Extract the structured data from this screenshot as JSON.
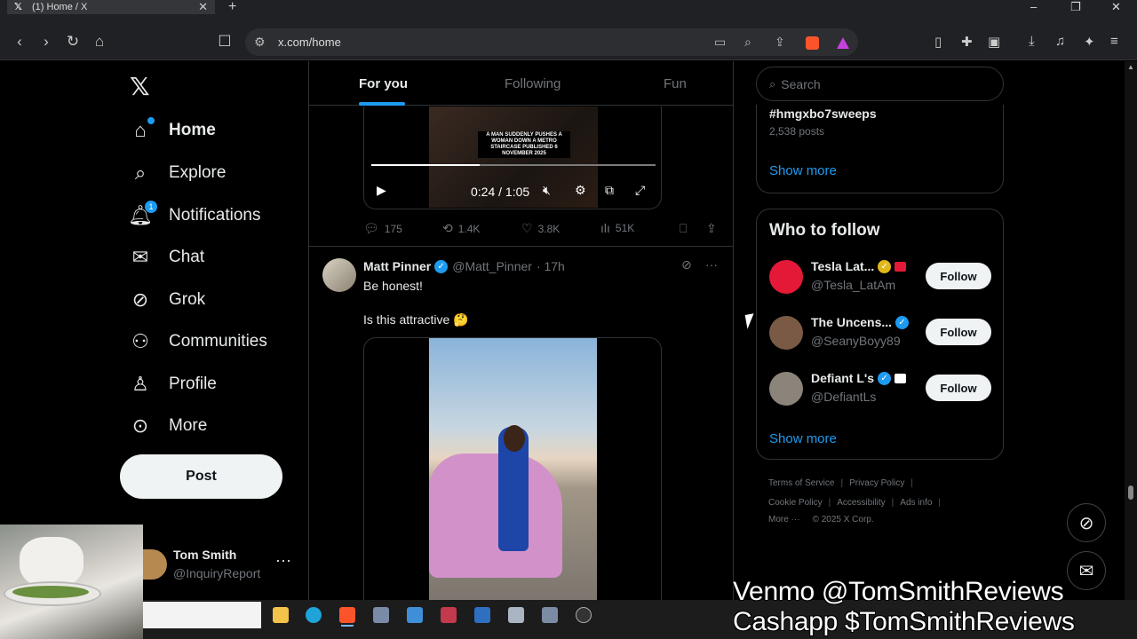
{
  "browser": {
    "tab_title": "(1) Home / X",
    "tab_icon": "x-logo-icon",
    "new_tab": "+",
    "url": "x.com/home",
    "window_controls": [
      "–",
      "❐",
      "✕"
    ]
  },
  "left_nav": {
    "logo": "𝕏",
    "items": [
      {
        "label": "Home",
        "icon": "home-icon",
        "active": true
      },
      {
        "label": "Explore",
        "icon": "search-icon"
      },
      {
        "label": "Notifications",
        "icon": "bell-icon",
        "badge": "1"
      },
      {
        "label": "Chat",
        "icon": "mail-icon"
      },
      {
        "label": "Grok",
        "icon": "grok-icon"
      },
      {
        "label": "Communities",
        "icon": "people-icon"
      },
      {
        "label": "Profile",
        "icon": "person-icon"
      },
      {
        "label": "More",
        "icon": "more-circle-icon"
      }
    ],
    "post_button": "Post",
    "account": {
      "name": "Tom Smith",
      "handle": "@InquiryReport",
      "more": "···"
    }
  },
  "feed": {
    "tabs": [
      {
        "label": "For you",
        "selected": true
      },
      {
        "label": "Following",
        "selected": false
      },
      {
        "label": "Fun",
        "selected": false
      }
    ],
    "video1": {
      "caption": "A MAN SUDDENLY PUSHES A WOMAN DOWN A METRO STAIRCASE PUBLISHED 6 NOVEMBER 2025",
      "time": "0:24 / 1:05",
      "progress": 0.38
    },
    "tweet1_actions": {
      "replies": "175",
      "reposts": "1.4K",
      "likes": "3.8K",
      "views": "51K"
    },
    "tweet2": {
      "name": "Matt Pinner",
      "handle": "@Matt_Pinner",
      "time": "· 17h",
      "line1": "Be honest!",
      "line2": "Is this attractive 🤔"
    }
  },
  "right": {
    "search_placeholder": "Search",
    "trend": {
      "tag": "#hmgxbo7sweeps",
      "posts": "2,538 posts",
      "show_more": "Show more"
    },
    "who_to_follow": {
      "title": "Who to follow",
      "suggestions": [
        {
          "name": "Tesla Lat...",
          "handle": "@Tesla_LatAm",
          "button": "Follow",
          "badge": "gold"
        },
        {
          "name": "The Uncens...",
          "handle": "@SeanyBoyy89",
          "button": "Follow",
          "badge": "blue"
        },
        {
          "name": "Defiant L's",
          "handle": "@DefiantLs",
          "button": "Follow",
          "badge": "blue"
        }
      ],
      "show_more": "Show more"
    },
    "footer": {
      "row1": [
        "Terms of Service",
        "Privacy Policy"
      ],
      "row2": [
        "Cookie Policy",
        "Accessibility",
        "Ads info"
      ],
      "row3": [
        "More ···",
        "© 2025 X Corp."
      ]
    }
  },
  "overlay": {
    "line1": "Venmo @TomSmithReviews",
    "line2": "Cashapp $TomSmithReviews"
  },
  "colors": {
    "accent": "#1d9bf0",
    "background": "#000000",
    "text": "#e7e9ea",
    "muted": "#71767b"
  }
}
